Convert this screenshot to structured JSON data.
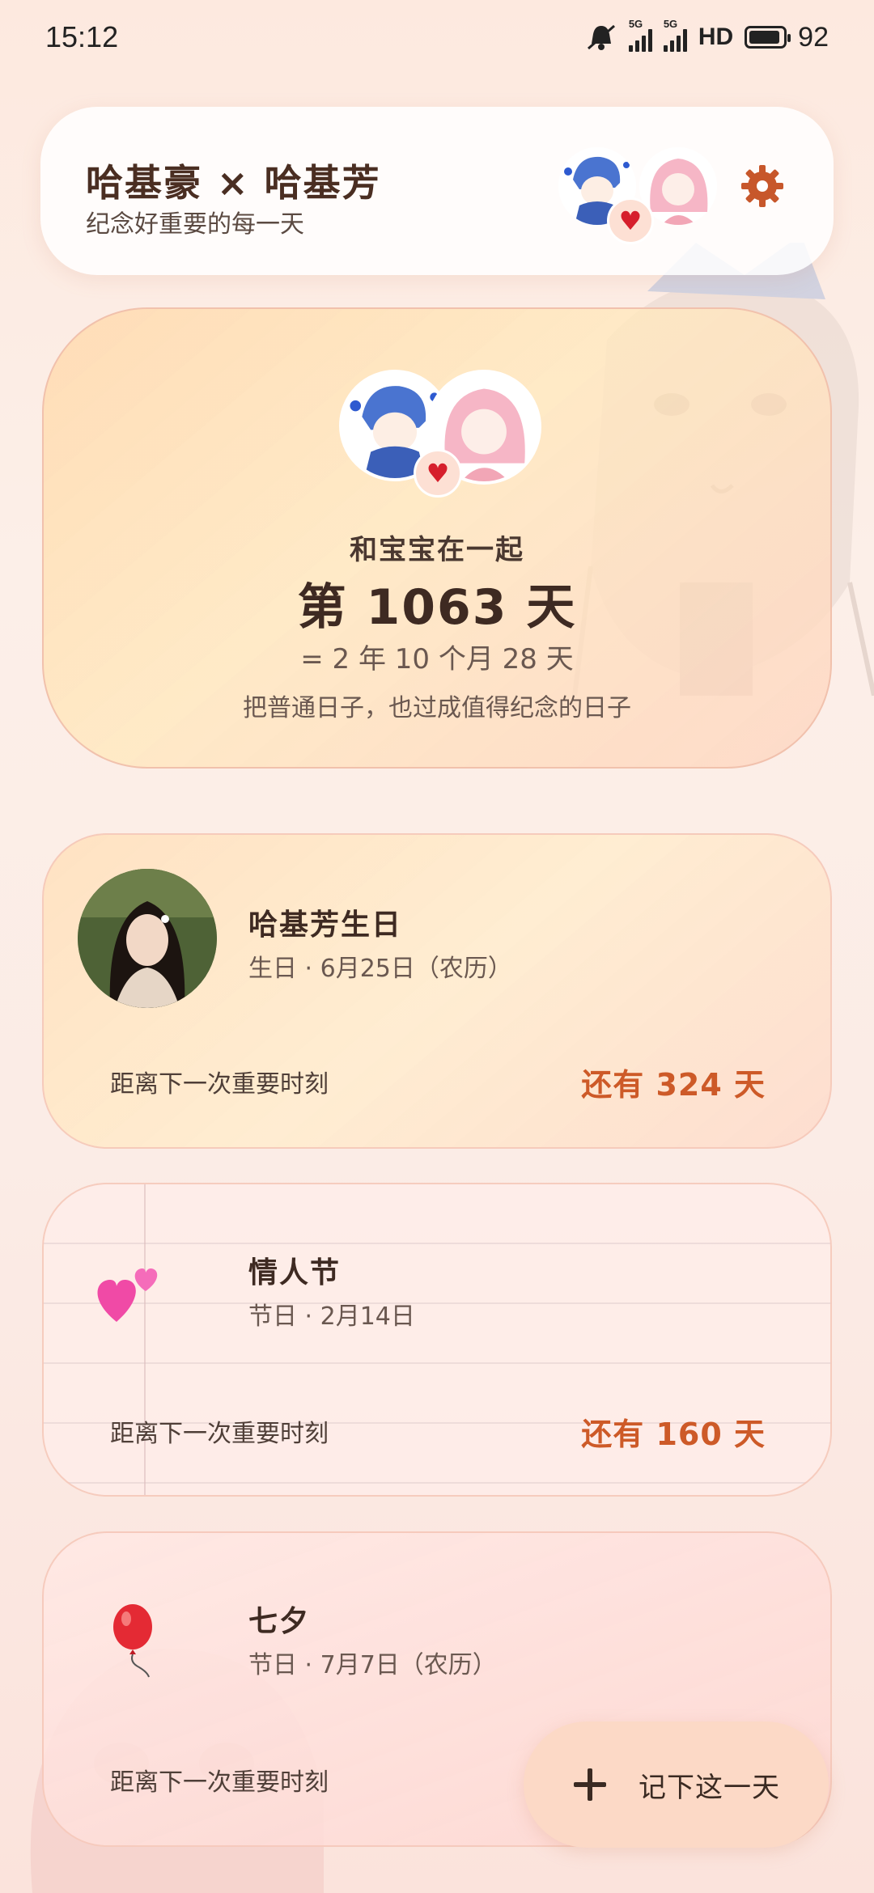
{
  "status_bar": {
    "time": "15:12",
    "network1": "5G",
    "network2": "5G",
    "hd": "HD",
    "battery": "92"
  },
  "header": {
    "title": "哈基豪 × 哈基芳",
    "subtitle": "纪念好重要的每一天",
    "icons": [
      "boy-avatar",
      "girl-avatar",
      "heart-icon",
      "gear-icon"
    ]
  },
  "counter": {
    "together_label": "和宝宝在一起",
    "days": "第 1063 天",
    "breakdown": "= 2 年 10 个月 28 天",
    "quote": "把普通日子，也过成值得纪念的日子"
  },
  "events": [
    {
      "title": "哈基芳生日",
      "date": "生日 · 6月25日（农历）",
      "distance_label": "距离下一次重要时刻",
      "countdown": "还有 324 天",
      "icon": "photo-avatar"
    },
    {
      "title": "情人节",
      "date": "节日 · 2月14日",
      "distance_label": "距离下一次重要时刻",
      "countdown": "还有 160 天",
      "icon": "two-hearts-icon"
    },
    {
      "title": "七夕",
      "date": "节日 · 7月7日（农历）",
      "distance_label": "距离下一次重要时刻",
      "icon": "balloon-icon"
    }
  ],
  "fab": {
    "label": "记下这一天"
  },
  "colors": {
    "accent": "#cd5a28",
    "gear": "#c7572b",
    "fab_bg": "#fcd9c6"
  }
}
